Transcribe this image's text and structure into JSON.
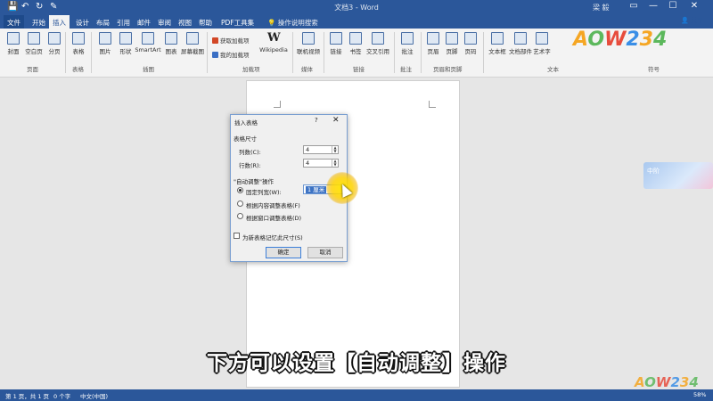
{
  "titlebar": {
    "doc_title": "文档3 - Word",
    "user": "梁 毅",
    "quick_access": [
      "💾",
      "↶",
      "↻",
      "✎"
    ],
    "window_buttons": [
      "▭",
      "—",
      "☐",
      "✕"
    ]
  },
  "tabs": [
    "文件",
    "开始",
    "插入",
    "设计",
    "布局",
    "引用",
    "邮件",
    "审阅",
    "视图",
    "帮助",
    "PDF工具集",
    "操作说明搜索"
  ],
  "share_label": "共享",
  "ribbon": {
    "buttons": {
      "cover": "封面",
      "blank": "空白页",
      "pagebreak": "分页",
      "table": "表格",
      "picture": "图片",
      "shapes": "形状",
      "smartart": "SmartArt",
      "chart": "图表",
      "screenshot": "屏幕截图",
      "wikipedia": "Wikipedia",
      "video": "联机视频",
      "link": "链接",
      "bookmark": "书签",
      "crossref": "交叉引用",
      "comment": "批注",
      "header": "页眉",
      "footer": "页脚",
      "pagenum": "页码",
      "textbox": "文本框",
      "docparts": "文档部件",
      "wordart": "艺术字"
    },
    "addins": {
      "get": "获取加载项",
      "mine": "我的加载项"
    },
    "groups": {
      "pages": "页面",
      "tables": "表格",
      "illustrations": "插图",
      "addins": "加载项",
      "media": "媒体",
      "links": "链接",
      "comments": "批注",
      "headerfooter": "页眉和页脚",
      "text": "文本",
      "symbols": "符号"
    }
  },
  "dialog": {
    "title": "插入表格",
    "help": "?",
    "close": "✕",
    "size_section": "表格尺寸",
    "columns_label": "列数(C):",
    "columns_value": "4",
    "rows_label": "行数(R):",
    "rows_value": "4",
    "autofit_section": "\"自动调整\"操作",
    "fixed_label": "固定列宽(W):",
    "fixed_value": "1 厘米",
    "content_label": "根据内容调整表格(F)",
    "window_label": "根据窗口调整表格(D)",
    "remember_label": "为新表格记忆此尺寸(S)",
    "ok": "确定",
    "cancel": "取消"
  },
  "caption": "下方可以设置【自动调整】操作",
  "side_image_text": "中阶",
  "logo": {
    "a": "A",
    "o": "O",
    "w": "W",
    "d2": "2",
    "d3": "3",
    "d4": "4"
  },
  "statusbar": {
    "page": "第 1 页，共 1 页",
    "words": "0 个字",
    "lang": "中文(中国)",
    "zoom": "58%"
  }
}
